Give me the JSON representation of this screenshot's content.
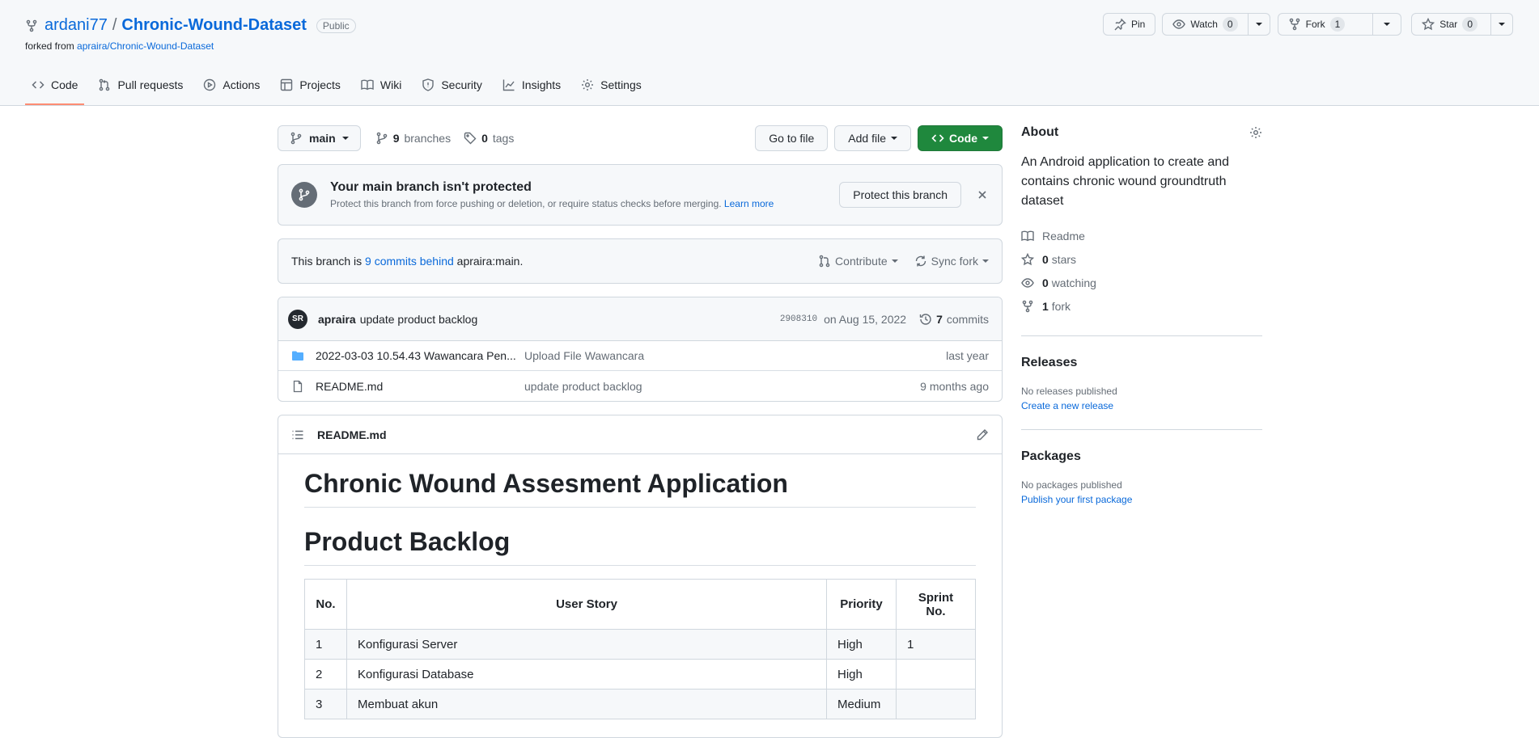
{
  "header": {
    "owner": "ardani77",
    "separator": "/",
    "repo": "Chronic-Wound-Dataset",
    "visibility": "Public",
    "forked_prefix": "forked from",
    "forked_from": "apraira/Chronic-Wound-Dataset"
  },
  "actions": {
    "pin": "Pin",
    "watch": "Watch",
    "watch_count": "0",
    "fork": "Fork",
    "fork_count": "1",
    "star": "Star",
    "star_count": "0"
  },
  "nav": [
    {
      "label": "Code",
      "icon": "code-icon",
      "active": true
    },
    {
      "label": "Pull requests",
      "icon": "pull-request-icon"
    },
    {
      "label": "Actions",
      "icon": "play-icon"
    },
    {
      "label": "Projects",
      "icon": "table-icon"
    },
    {
      "label": "Wiki",
      "icon": "book-icon"
    },
    {
      "label": "Security",
      "icon": "shield-icon"
    },
    {
      "label": "Insights",
      "icon": "graph-icon"
    },
    {
      "label": "Settings",
      "icon": "gear-icon"
    }
  ],
  "toolbar": {
    "branch": "main",
    "branches_count": "9",
    "branches_label": "branches",
    "tags_count": "0",
    "tags_label": "tags",
    "go_to_file": "Go to file",
    "add_file": "Add file",
    "code": "Code"
  },
  "protect": {
    "title": "Your main branch isn't protected",
    "desc": "Protect this branch from force pushing or deletion, or require status checks before merging.",
    "learn_more": "Learn more",
    "button": "Protect this branch"
  },
  "behind": {
    "prefix": "This branch is",
    "link": "9 commits behind",
    "suffix": "apraira:main.",
    "contribute": "Contribute",
    "sync": "Sync fork"
  },
  "commit": {
    "avatar": "SR",
    "author": "apraira",
    "message": "update product backlog",
    "sha": "2908310",
    "date": "on Aug 15, 2022",
    "count": "7",
    "count_label": "commits"
  },
  "files": [
    {
      "type": "folder",
      "name": "2022-03-03 10.54.43 Wawancara Pen...",
      "message": "Upload File Wawancara",
      "age": "last year"
    },
    {
      "type": "file",
      "name": "README.md",
      "message": "update product backlog",
      "age": "9 months ago"
    }
  ],
  "readme": {
    "filename": "README.md",
    "h1": "Chronic Wound Assesment Application",
    "h2": "Product Backlog",
    "table": {
      "headers": [
        "No.",
        "User Story",
        "Priority",
        "Sprint No."
      ],
      "rows": [
        [
          "1",
          "Konfigurasi Server",
          "High",
          "1"
        ],
        [
          "2",
          "Konfigurasi Database",
          "High",
          ""
        ],
        [
          "3",
          "Membuat akun",
          "Medium",
          ""
        ]
      ]
    }
  },
  "sidebar": {
    "about_title": "About",
    "about_text": "An Android application to create and contains chronic wound groundtruth dataset",
    "readme": "Readme",
    "stars_count": "0",
    "stars_label": "stars",
    "watching_count": "0",
    "watching_label": "watching",
    "forks_count": "1",
    "forks_label": "fork",
    "releases_title": "Releases",
    "releases_none": "No releases published",
    "releases_link": "Create a new release",
    "packages_title": "Packages",
    "packages_none": "No packages published",
    "packages_link": "Publish your first package"
  },
  "colors": {
    "accent": "#0969da",
    "primary_button": "#1f883d",
    "nav_active": "#fd8c73",
    "folder": "#54aeff"
  }
}
